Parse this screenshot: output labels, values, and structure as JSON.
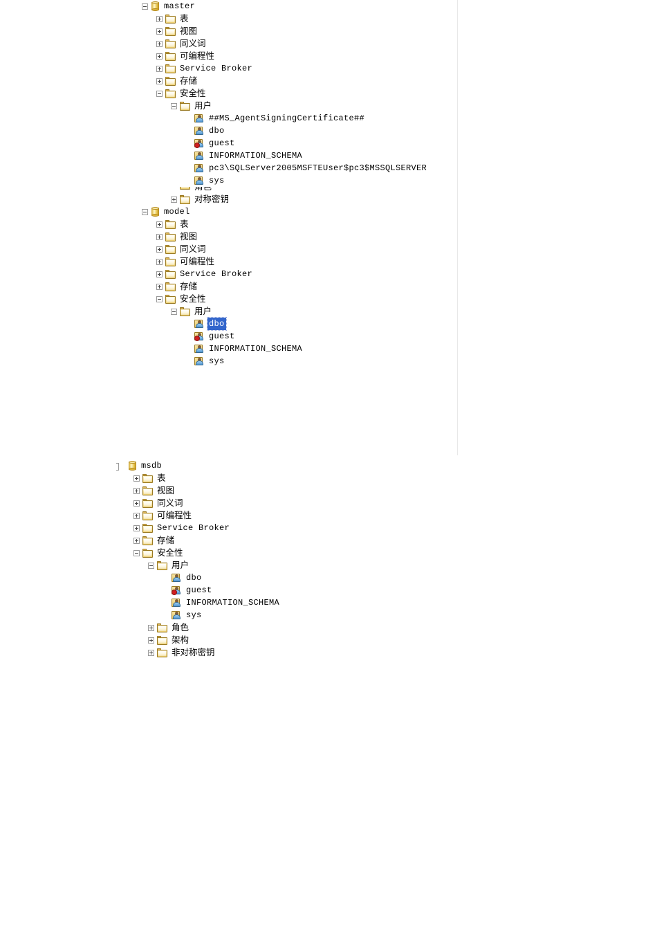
{
  "app": {
    "name": "SQL Server Management Studio Object Explorer",
    "view": "database-tree"
  },
  "colors": {
    "selection_bg": "#3366cc",
    "selection_fg": "#ffffff",
    "folder": "#eccd6b",
    "database": "#dcb53d",
    "panel_border": "#e8e8e8",
    "text": "#000000"
  },
  "icons": {
    "database": "database-cylinder-icon",
    "folder": "folder-icon",
    "user": "user-icon",
    "user_disabled": "user-disabled-icon",
    "expander_plus": "expander-plus-icon",
    "expander_minus": "expander-minus-icon"
  },
  "panels": [
    {
      "id": "master-model",
      "name": "object-explorer-panel-top",
      "nodes": [
        {
          "label": "master",
          "icon": "database",
          "expander": "minus",
          "depth": 0,
          "cjk": false
        },
        {
          "label": "表",
          "icon": "folder",
          "expander": "plus",
          "depth": 1,
          "cjk": true
        },
        {
          "label": "视图",
          "icon": "folder",
          "expander": "plus",
          "depth": 1,
          "cjk": true
        },
        {
          "label": "同义词",
          "icon": "folder",
          "expander": "plus",
          "depth": 1,
          "cjk": true
        },
        {
          "label": "可编程性",
          "icon": "folder",
          "expander": "plus",
          "depth": 1,
          "cjk": true
        },
        {
          "label": "Service Broker",
          "icon": "folder",
          "expander": "plus",
          "depth": 1,
          "cjk": false
        },
        {
          "label": "存储",
          "icon": "folder",
          "expander": "plus",
          "depth": 1,
          "cjk": true
        },
        {
          "label": "安全性",
          "icon": "folder",
          "expander": "minus",
          "depth": 1,
          "cjk": true
        },
        {
          "label": "用户",
          "icon": "folder",
          "expander": "minus",
          "depth": 2,
          "cjk": true
        },
        {
          "label": "##MS_AgentSigningCertificate##",
          "icon": "user",
          "expander": "none",
          "depth": 3,
          "cjk": false
        },
        {
          "label": "dbo",
          "icon": "user",
          "expander": "none",
          "depth": 3,
          "cjk": false
        },
        {
          "label": "guest",
          "icon": "user_disabled",
          "expander": "none",
          "depth": 3,
          "cjk": false
        },
        {
          "label": "INFORMATION_SCHEMA",
          "icon": "user",
          "expander": "none",
          "depth": 3,
          "cjk": false
        },
        {
          "label": "pc3\\SQLServer2005MSFTEUser$pc3$MSSQLSERVER",
          "icon": "user",
          "expander": "none",
          "depth": 3,
          "cjk": false
        },
        {
          "label": "sys",
          "icon": "user",
          "expander": "none",
          "depth": 3,
          "cjk": false
        },
        {
          "label": "角色",
          "icon": "folder",
          "expander": "minus",
          "depth": 2,
          "cjk": true,
          "clipped": true
        },
        {
          "label": "对称密钥",
          "icon": "folder",
          "expander": "plus",
          "depth": 2,
          "cjk": true
        },
        {
          "label": "model",
          "icon": "database",
          "expander": "minus",
          "depth": 0,
          "cjk": false
        },
        {
          "label": "表",
          "icon": "folder",
          "expander": "plus",
          "depth": 1,
          "cjk": true
        },
        {
          "label": "视图",
          "icon": "folder",
          "expander": "plus",
          "depth": 1,
          "cjk": true
        },
        {
          "label": "同义词",
          "icon": "folder",
          "expander": "plus",
          "depth": 1,
          "cjk": true
        },
        {
          "label": "可编程性",
          "icon": "folder",
          "expander": "plus",
          "depth": 1,
          "cjk": true
        },
        {
          "label": "Service Broker",
          "icon": "folder",
          "expander": "plus",
          "depth": 1,
          "cjk": false
        },
        {
          "label": "存储",
          "icon": "folder",
          "expander": "plus",
          "depth": 1,
          "cjk": true
        },
        {
          "label": "安全性",
          "icon": "folder",
          "expander": "minus",
          "depth": 1,
          "cjk": true
        },
        {
          "label": "用户",
          "icon": "folder",
          "expander": "minus",
          "depth": 2,
          "cjk": true
        },
        {
          "label": "dbo",
          "icon": "user",
          "expander": "none",
          "depth": 3,
          "cjk": false,
          "selected": true
        },
        {
          "label": "guest",
          "icon": "user_disabled",
          "expander": "none",
          "depth": 3,
          "cjk": false
        },
        {
          "label": "INFORMATION_SCHEMA",
          "icon": "user",
          "expander": "none",
          "depth": 3,
          "cjk": false
        },
        {
          "label": "sys",
          "icon": "user",
          "expander": "none",
          "depth": 3,
          "cjk": false
        }
      ]
    },
    {
      "id": "msdb",
      "name": "object-explorer-panel-bottom",
      "nodes": [
        {
          "label": "msdb",
          "icon": "database",
          "expander": "clipped",
          "depth": 0,
          "cjk": false
        },
        {
          "label": "表",
          "icon": "folder",
          "expander": "plus",
          "depth": 1,
          "cjk": true
        },
        {
          "label": "视图",
          "icon": "folder",
          "expander": "plus",
          "depth": 1,
          "cjk": true
        },
        {
          "label": "同义词",
          "icon": "folder",
          "expander": "plus",
          "depth": 1,
          "cjk": true
        },
        {
          "label": "可编程性",
          "icon": "folder",
          "expander": "plus",
          "depth": 1,
          "cjk": true
        },
        {
          "label": "Service Broker",
          "icon": "folder",
          "expander": "plus",
          "depth": 1,
          "cjk": false
        },
        {
          "label": "存储",
          "icon": "folder",
          "expander": "plus",
          "depth": 1,
          "cjk": true
        },
        {
          "label": "安全性",
          "icon": "folder",
          "expander": "minus",
          "depth": 1,
          "cjk": true
        },
        {
          "label": "用户",
          "icon": "folder",
          "expander": "minus",
          "depth": 2,
          "cjk": true
        },
        {
          "label": "dbo",
          "icon": "user",
          "expander": "none",
          "depth": 3,
          "cjk": false
        },
        {
          "label": "guest",
          "icon": "user_disabled",
          "expander": "none",
          "depth": 3,
          "cjk": false
        },
        {
          "label": "INFORMATION_SCHEMA",
          "icon": "user",
          "expander": "none",
          "depth": 3,
          "cjk": false
        },
        {
          "label": "sys",
          "icon": "user",
          "expander": "none",
          "depth": 3,
          "cjk": false
        },
        {
          "label": "角色",
          "icon": "folder",
          "expander": "plus",
          "depth": 2,
          "cjk": true
        },
        {
          "label": "架构",
          "icon": "folder",
          "expander": "plus",
          "depth": 2,
          "cjk": true
        },
        {
          "label": "非对称密钥",
          "icon": "folder",
          "expander": "plus",
          "depth": 2,
          "cjk": true
        }
      ]
    }
  ]
}
